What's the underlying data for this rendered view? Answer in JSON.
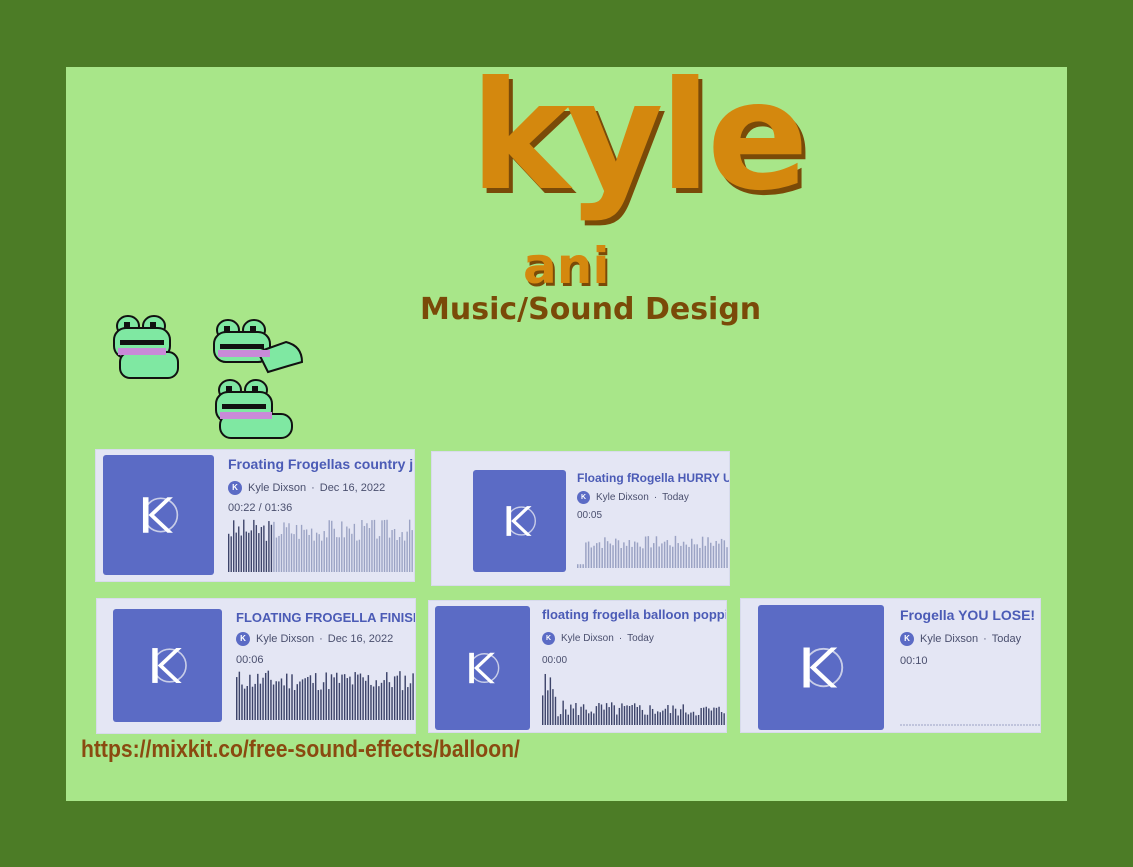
{
  "logo": {
    "word": "kyle",
    "sub": "ani",
    "color": "#d4880e",
    "shadow": "#7a4a08"
  },
  "tagline": "Music/Sound Design",
  "url": "https://mixkit.co/free-sound-effects/balloon/",
  "colors": {
    "background": "#4c7c26",
    "panel": "#a8e689",
    "card": "#e4e6f4",
    "accent": "#5b6bc5",
    "wave_dark": "#3d446a",
    "wave_light": "#9ba3c4"
  },
  "cards": [
    {
      "title": "Froating Frogellas country jig",
      "avatar": "K",
      "author": "Kyle Dixson",
      "date": "Dec 16, 2022",
      "time": "00:22 / 01:36",
      "progress": 0.23
    },
    {
      "title": "Floating fRogella HURRY UP! (",
      "avatar": "K",
      "author": "Kyle Dixson",
      "date": "Today",
      "time": "00:05",
      "progress": 0
    },
    {
      "title": "FLOATING FROGELLA FINISH",
      "avatar": "K",
      "author": "Kyle Dixson",
      "date": "Dec 16, 2022",
      "time": "00:06",
      "progress": 1
    },
    {
      "title": "floating frogella balloon popping (",
      "avatar": "K",
      "author": "Kyle Dixson",
      "date": "Today",
      "time": "00:00",
      "progress": 1
    },
    {
      "title": "Frogella YOU LOSE!",
      "avatar": "K",
      "author": "Kyle Dixson",
      "date": "Today",
      "time": "00:10",
      "progress": 0
    }
  ]
}
